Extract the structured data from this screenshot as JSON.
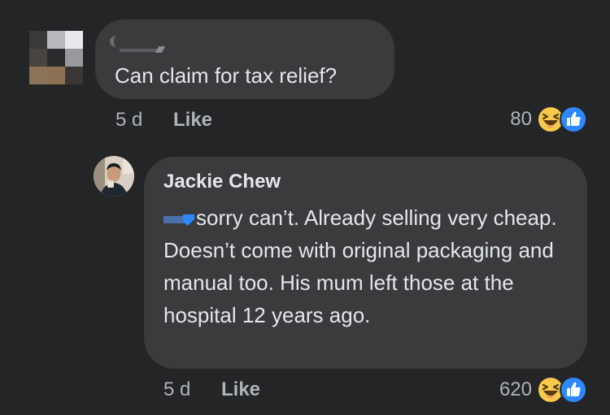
{
  "comment": {
    "text": "Can claim for tax relief?",
    "time": "5 d",
    "like_label": "Like",
    "reaction_count": "80"
  },
  "reply": {
    "author": "Jackie Chew",
    "text": "sorry can’t. Already selling very cheap. Doesn’t come with original packaging and manual too. His mum left those at the hospital 12 years ago.",
    "time": "5 d",
    "like_label": "Like",
    "reaction_count": "620"
  },
  "colors": {
    "background": "#242526",
    "bubble": "#3a3b3c",
    "text_primary": "#e4e6eb",
    "text_secondary": "#b0b3b8",
    "like_blue": "#2d88ff",
    "haha_yellow": "#f7c94a"
  },
  "icons": {
    "haha": "haha-reaction-icon",
    "like": "like-reaction-icon"
  }
}
